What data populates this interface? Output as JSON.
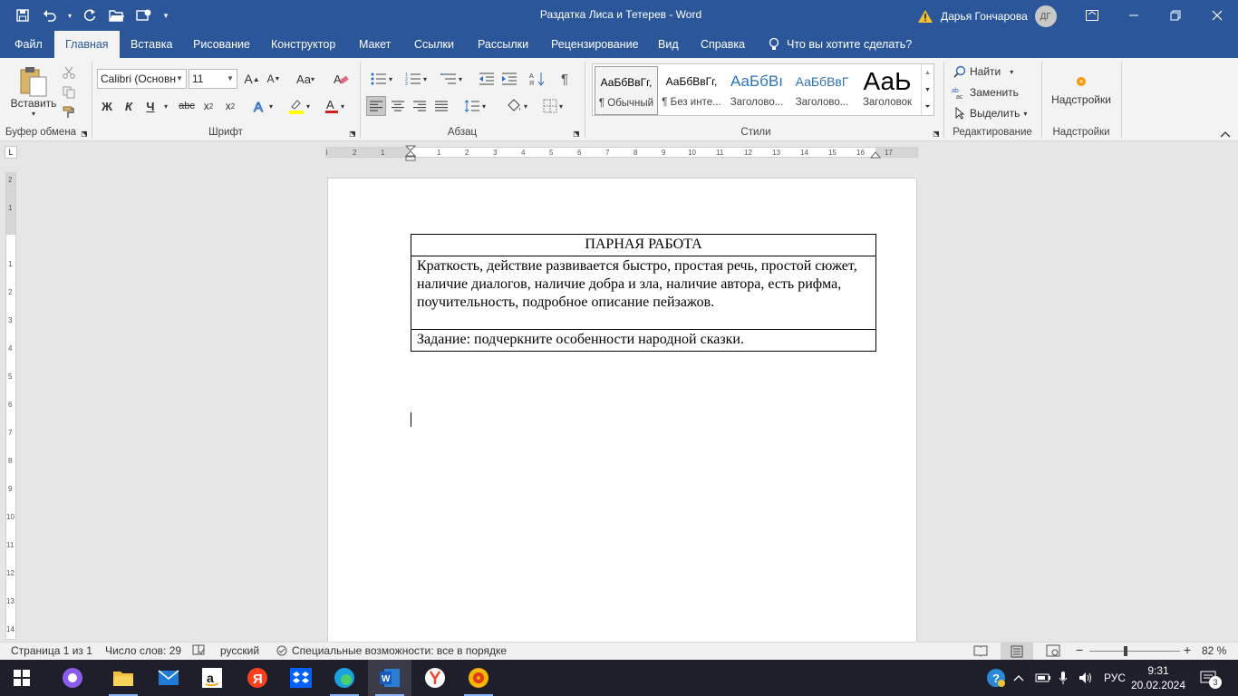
{
  "window": {
    "title": "Раздатка Лиса и Тетерев  -  Word",
    "user_name": "Дарья Гончарова",
    "user_initials": "ДГ"
  },
  "tabs": [
    "Файл",
    "Главная",
    "Вставка",
    "Рисование",
    "Конструктор",
    "Макет",
    "Ссылки",
    "Рассылки",
    "Рецензирование",
    "Вид",
    "Справка"
  ],
  "active_tab": "Главная",
  "tell_me": "Что вы хотите сделать?",
  "ribbon": {
    "clipboard": {
      "paste_label": "Вставить",
      "group_label": "Буфер обмена"
    },
    "font": {
      "font_name": "Calibri (Основн",
      "font_size": "11",
      "group_label": "Шрифт",
      "bold": "Ж",
      "italic": "К",
      "underline": "Ч",
      "strike": "abc"
    },
    "paragraph": {
      "group_label": "Абзац"
    },
    "styles": {
      "group_label": "Стили",
      "items": [
        {
          "sample": "АаБбВвГг,",
          "name": "¶ Обычный"
        },
        {
          "sample": "АаБбВвГг,",
          "name": "¶ Без инте..."
        },
        {
          "sample": "АаБбВı",
          "name": "Заголово..."
        },
        {
          "sample": "АаБбВвГ",
          "name": "Заголово..."
        },
        {
          "sample": "АаЬ",
          "name": "Заголовок"
        }
      ]
    },
    "editing": {
      "find": "Найти",
      "replace": "Заменить",
      "select": "Выделить",
      "group_label": "Редактирование"
    },
    "addins": {
      "label": "Надстройки",
      "group_label": "Надстройки"
    }
  },
  "document": {
    "table": {
      "header": "ПАРНАЯ РАБОТА",
      "body": "Краткость, действие развивается быстро, простая речь, простой сюжет, наличие диалогов, наличие добра и зла, наличие автора, есть рифма, поучительность, подробное описание пейзажов.",
      "task": "Задание: подчеркните особенности народной сказки."
    }
  },
  "status": {
    "page": "Страница 1 из 1",
    "words": "Число слов: 29",
    "language": "русский",
    "accessibility": "Специальные возможности: все в порядке",
    "zoom": "82 %"
  },
  "taskbar": {
    "lang": "РУС",
    "time": "9:31",
    "date": "20.02.2024",
    "notifications": "3"
  }
}
